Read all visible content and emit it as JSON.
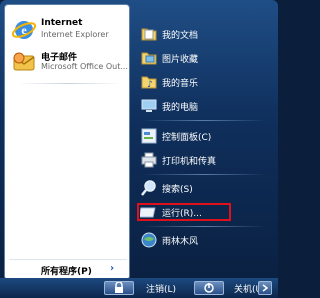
{
  "pinned": [
    {
      "title": "Internet",
      "subtitle": "Internet Explorer",
      "icon": "internet-explorer-icon"
    },
    {
      "title": "电子邮件",
      "subtitle": "Microsoft Office Out...",
      "icon": "outlook-mail-icon"
    }
  ],
  "all_programs": {
    "label": "所有程序(P)",
    "arrow": "›"
  },
  "right_items": {
    "documents": "我的文档",
    "pictures": "图片收藏",
    "music": "我的音乐",
    "computer": "我的电脑",
    "control_panel": "控制面板(C)",
    "printers": "打印机和传真",
    "search": "搜索(S)",
    "run": "运行(R)...",
    "user": "雨林木风"
  },
  "bottom": {
    "logoff": "注销(L)",
    "shutdown": "关机(U)"
  },
  "colors": {
    "highlight": "#e0101a",
    "panel_dark": "#0f2f5c"
  }
}
